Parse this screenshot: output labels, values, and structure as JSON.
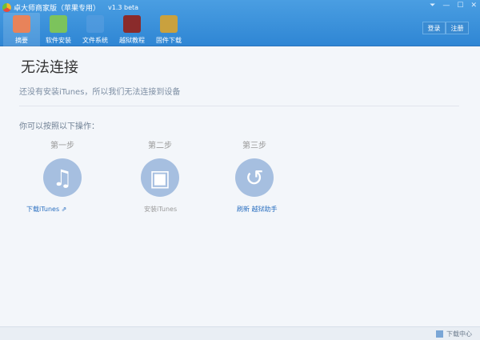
{
  "window": {
    "title": "卓大师商家版（苹果专用）",
    "version": "v1.3 beta"
  },
  "toolbar": [
    {
      "label": "摘要",
      "icon": "home-icon",
      "color": "#e8835a"
    },
    {
      "label": "软件安装",
      "icon": "apps-icon",
      "color": "#7cc35c"
    },
    {
      "label": "文件系统",
      "icon": "folder-icon",
      "color": "#5a9ee0"
    },
    {
      "label": "越狱教程",
      "icon": "book-icon",
      "color": "#8a2b2b"
    },
    {
      "label": "固件下载",
      "icon": "download-icon",
      "color": "#c9a13e"
    }
  ],
  "account": {
    "login": "登录",
    "register": "注册"
  },
  "main": {
    "title": "无法连接",
    "message": "还没有安装iTunes，所以我们无法连接到设备",
    "hint": "你可以按照以下操作：",
    "steps": [
      {
        "label": "第一步",
        "action": "下载iTunes ⇗"
      },
      {
        "label": "第二步",
        "action": "安装iTunes"
      },
      {
        "label": "第三步",
        "action": "刷新 越狱助手"
      }
    ]
  },
  "footer": {
    "download_center": "下载中心"
  }
}
